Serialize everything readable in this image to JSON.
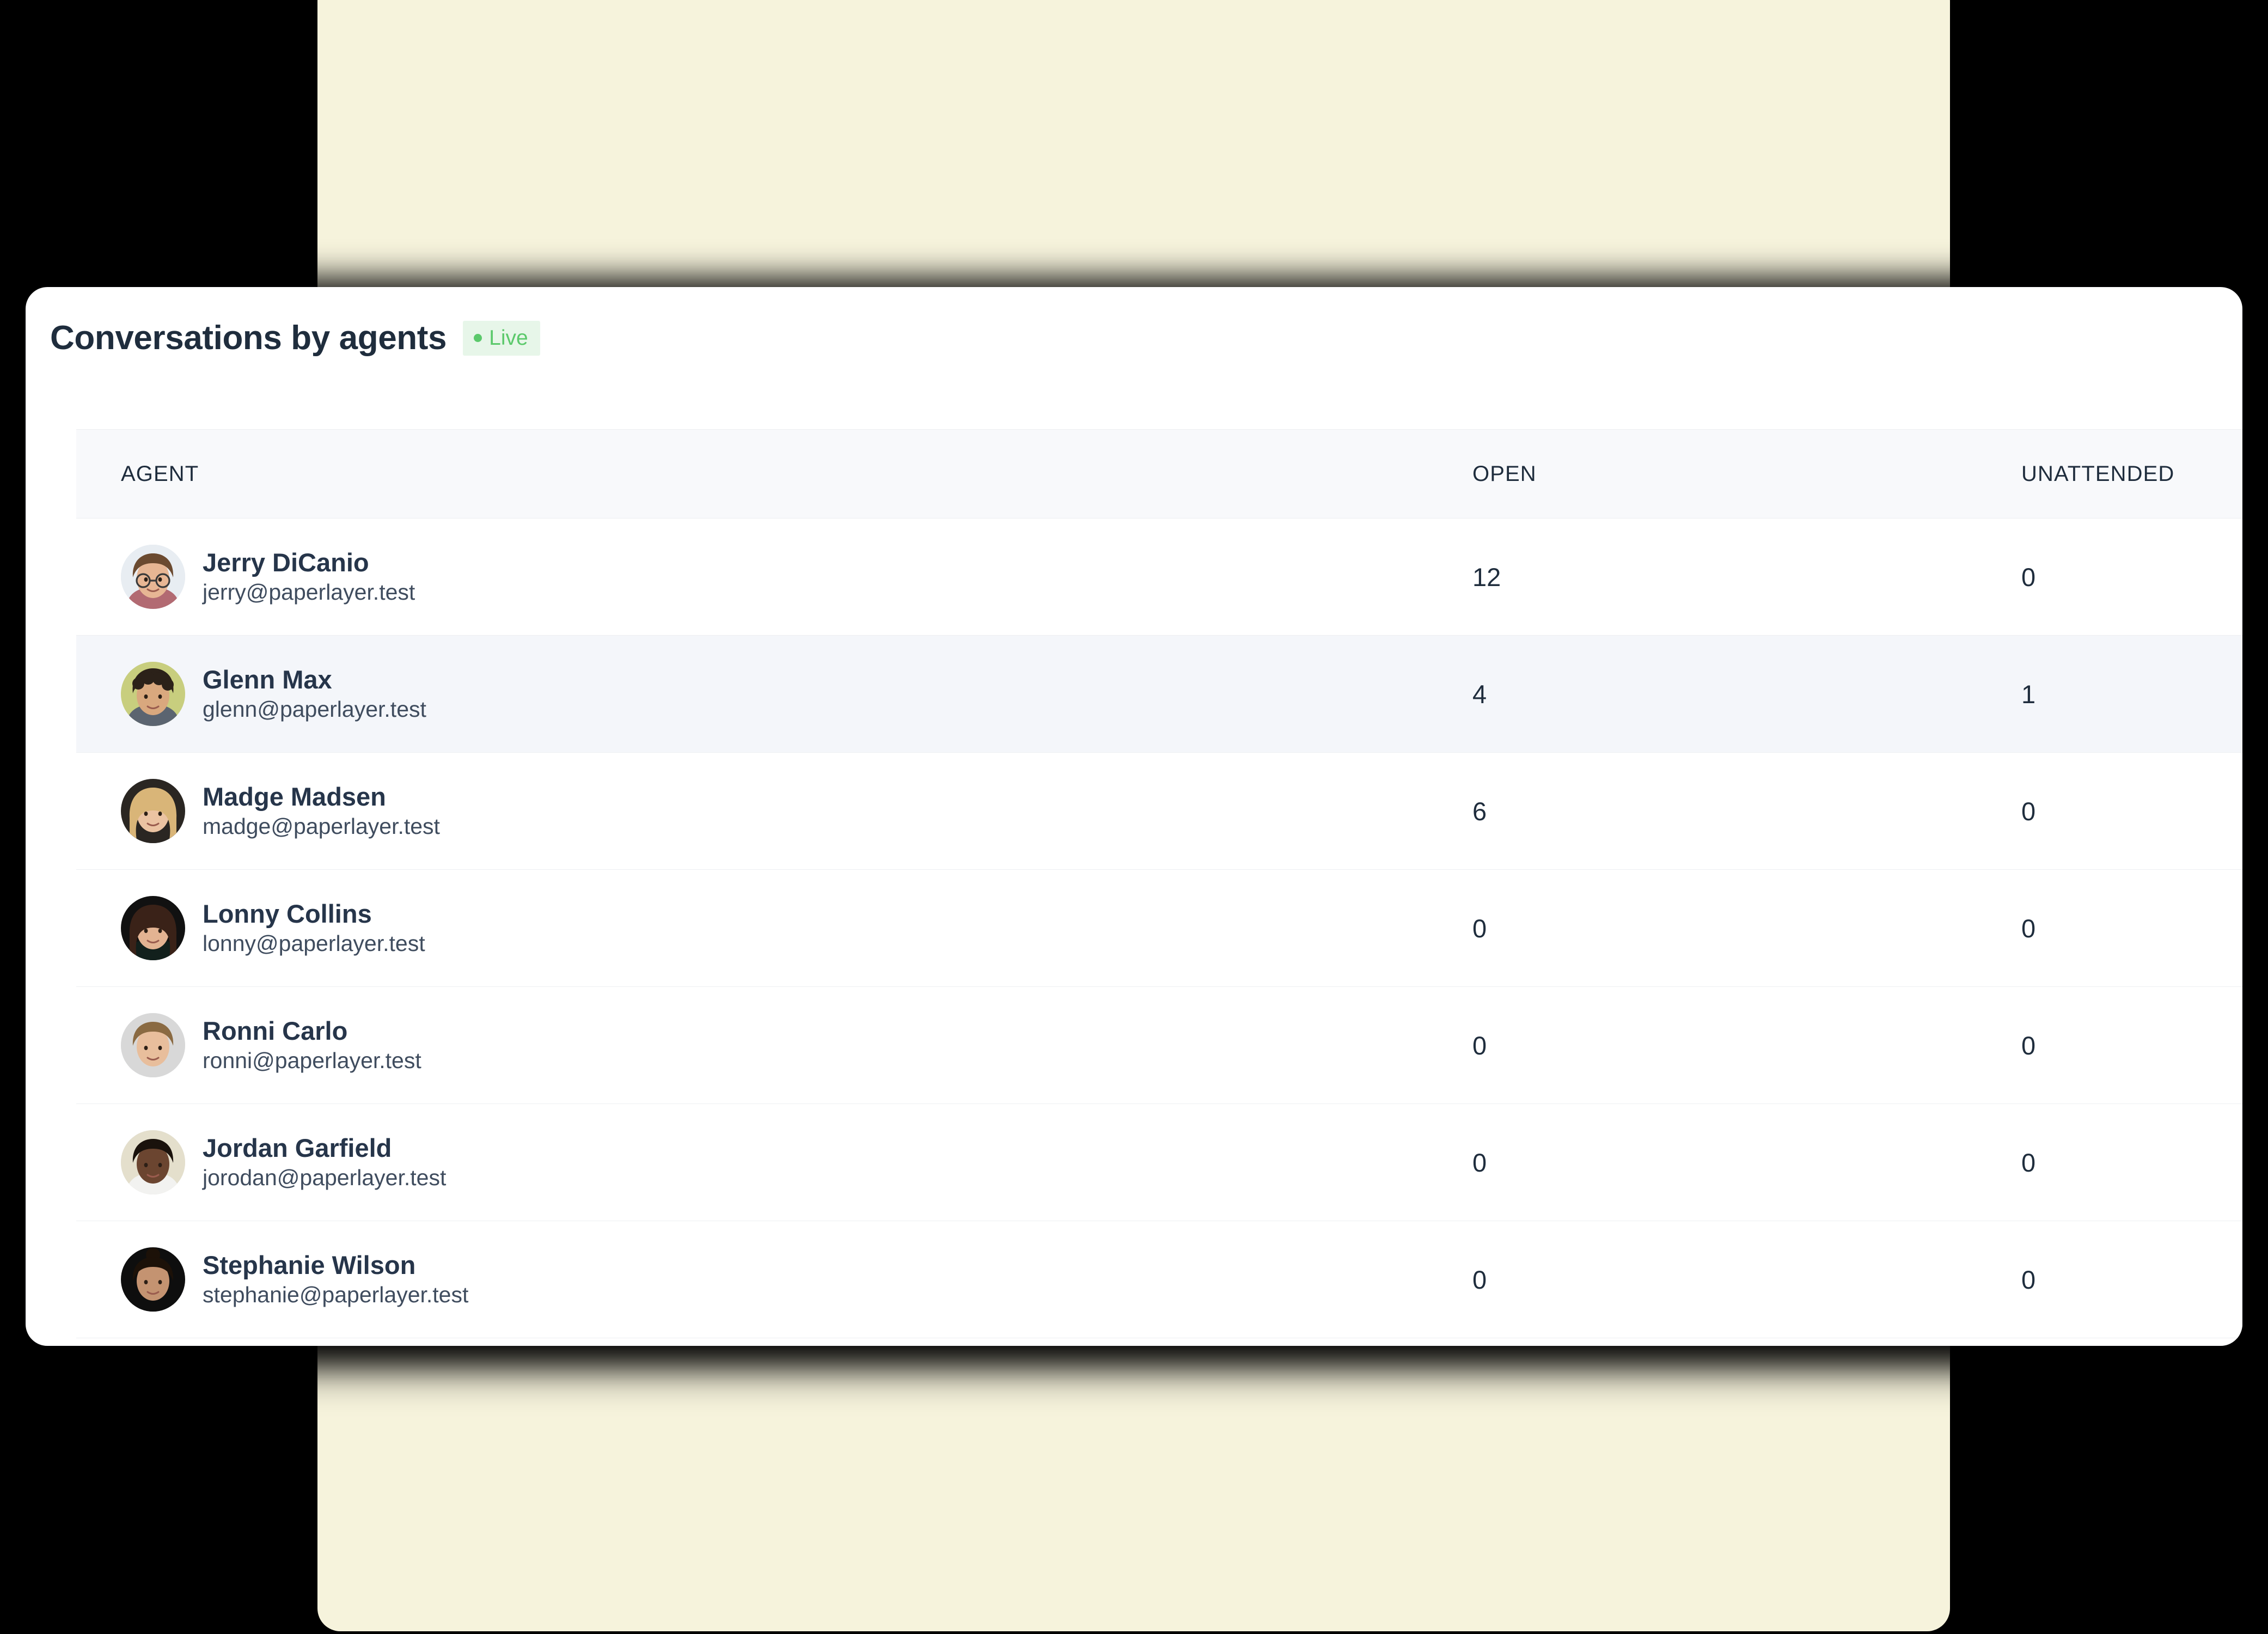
{
  "card": {
    "title": "Conversations by agents",
    "live_badge": {
      "label": "Live",
      "dot_color": "#5BC96B",
      "bg_color": "#E7F6E9"
    }
  },
  "table": {
    "columns": [
      {
        "key": "agent",
        "label": "AGENT"
      },
      {
        "key": "open",
        "label": "OPEN"
      },
      {
        "key": "unattended",
        "label": "UNATTENDED"
      }
    ],
    "rows": [
      {
        "name": "Jerry DiCanio",
        "email": "jerry@paperlayer.test",
        "open": "12",
        "unattended": "0",
        "highlighted": false
      },
      {
        "name": "Glenn Max",
        "email": "glenn@paperlayer.test",
        "open": "4",
        "unattended": "1",
        "highlighted": true
      },
      {
        "name": "Madge Madsen",
        "email": "madge@paperlayer.test",
        "open": "6",
        "unattended": "0",
        "highlighted": false
      },
      {
        "name": "Lonny Collins",
        "email": "lonny@paperlayer.test",
        "open": "0",
        "unattended": "0",
        "highlighted": false
      },
      {
        "name": "Ronni Carlo",
        "email": "ronni@paperlayer.test",
        "open": "0",
        "unattended": "0",
        "highlighted": false
      },
      {
        "name": "Jordan Garfield",
        "email": "jorodan@paperlayer.test",
        "open": "0",
        "unattended": "0",
        "highlighted": false
      },
      {
        "name": "Stephanie Wilson",
        "email": "stephanie@paperlayer.test",
        "open": "0",
        "unattended": "0",
        "highlighted": false
      }
    ]
  },
  "theme": {
    "page_bg": "#000000",
    "backdrop_panel_bg": "#F6F3DC",
    "card_bg": "#FFFFFF",
    "header_row_bg": "#F8F9FB",
    "highlight_row_bg": "#F4F6FA",
    "title_color": "#1F2D3D",
    "name_color": "#26354A",
    "email_color": "#3F4C5E"
  }
}
